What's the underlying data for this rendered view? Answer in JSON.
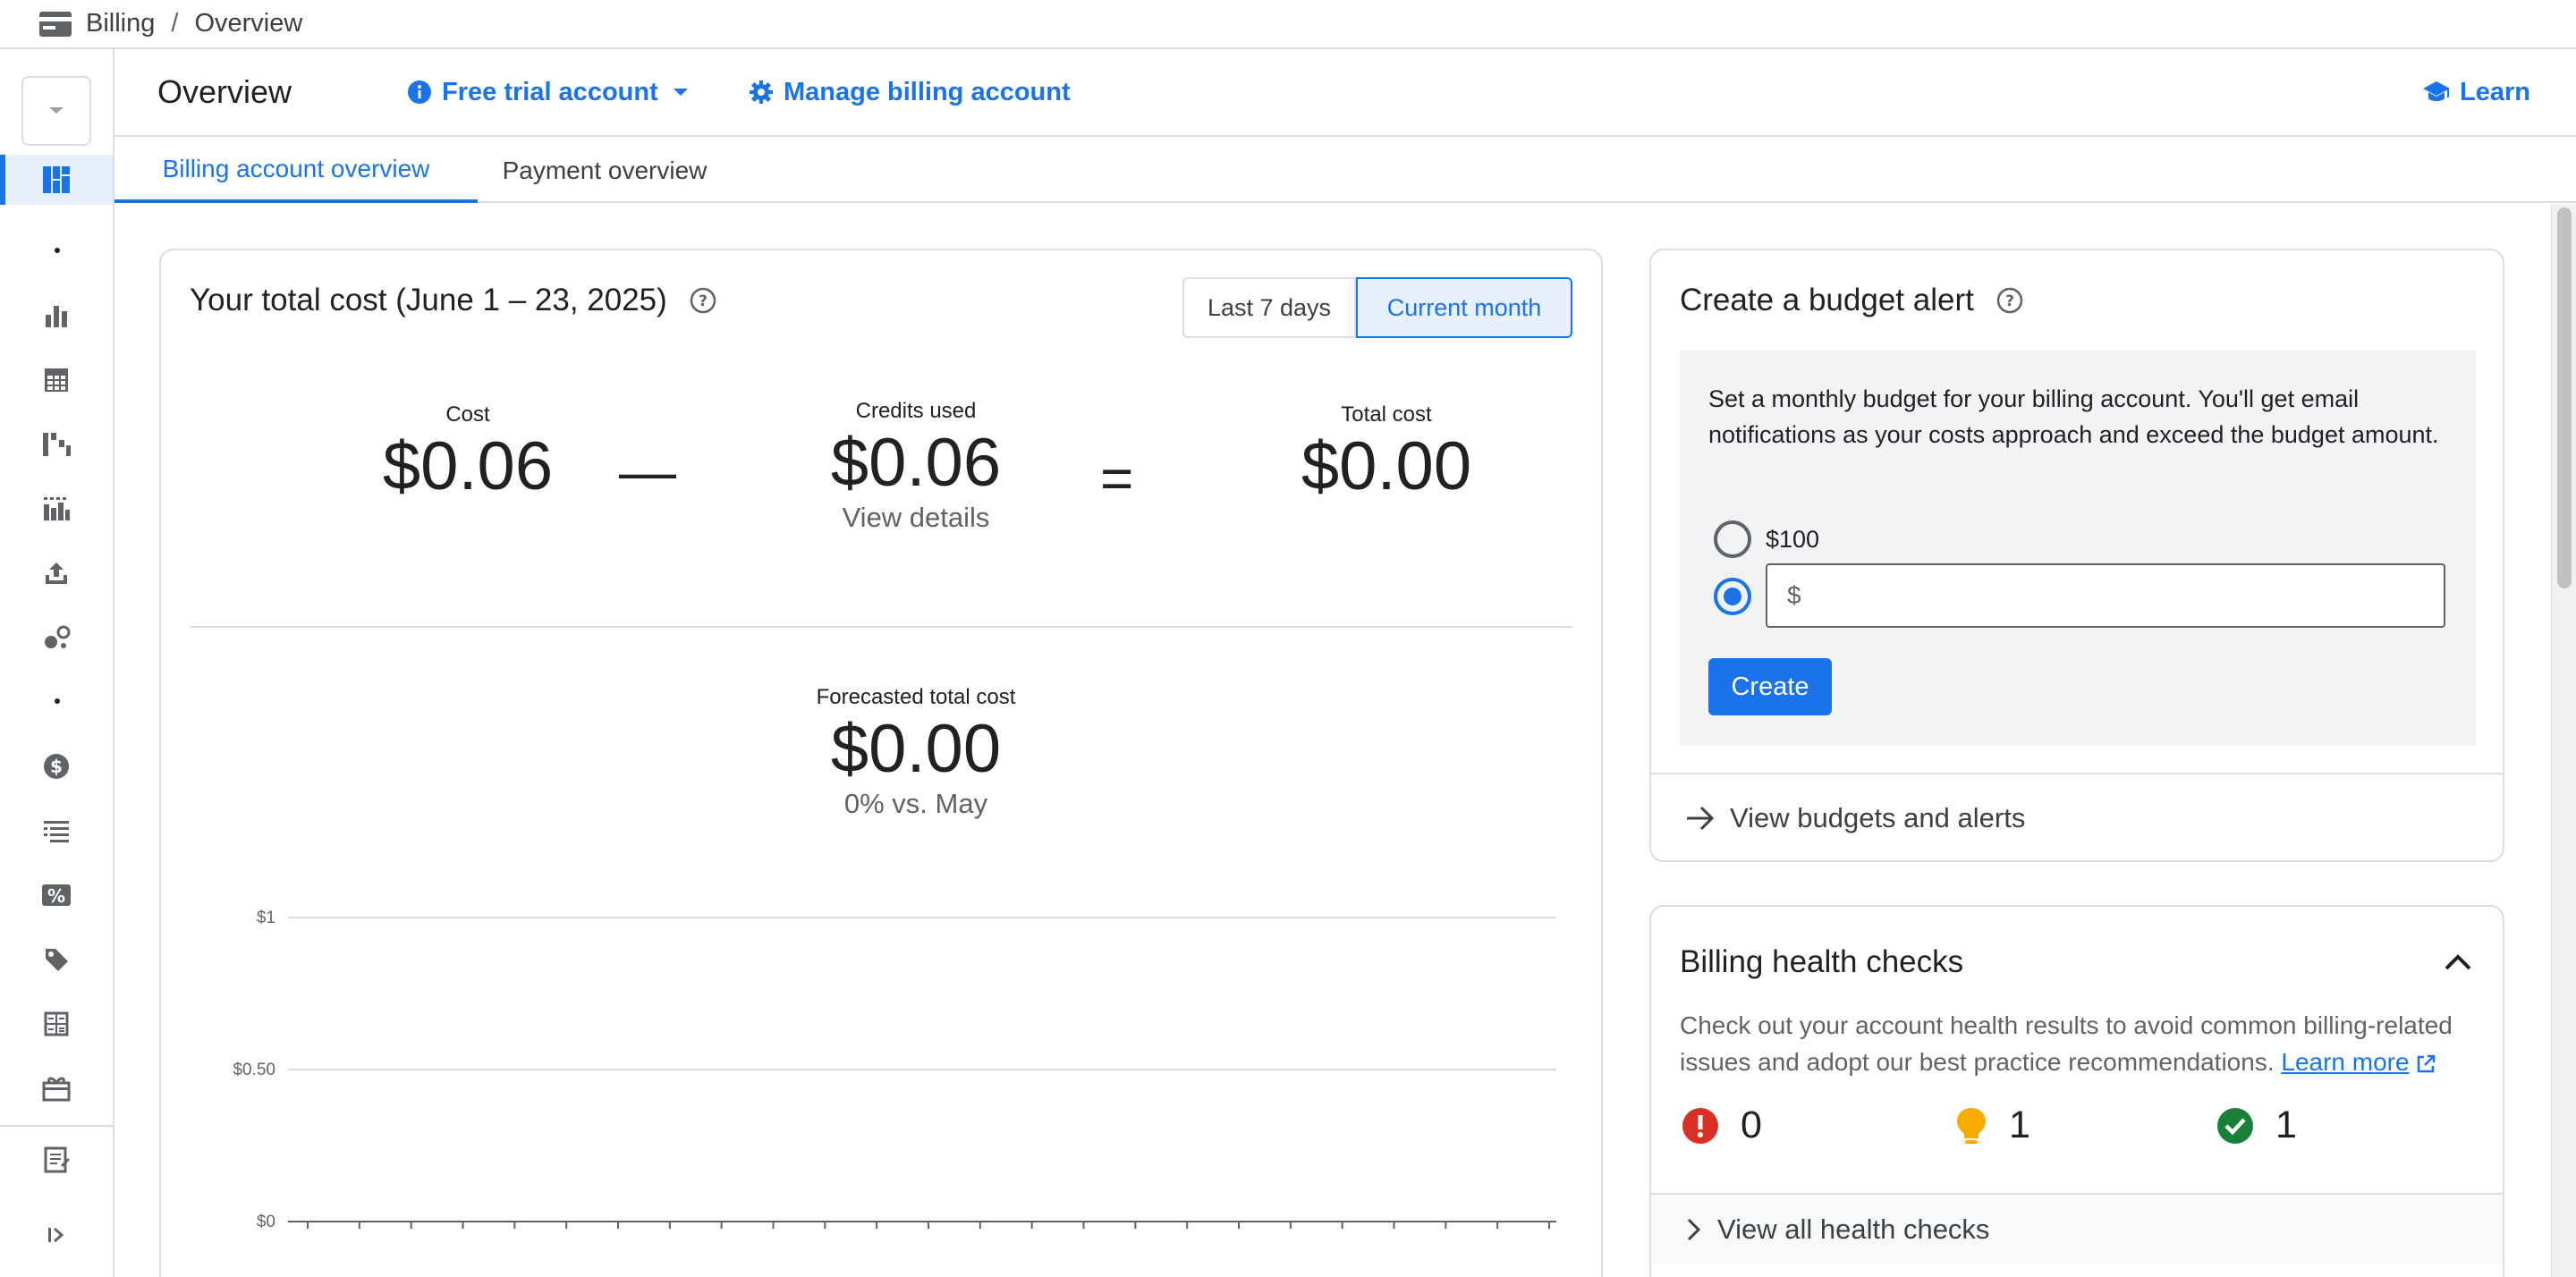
{
  "breadcrumb": {
    "items": [
      "Billing",
      "Overview"
    ],
    "separator": "/"
  },
  "header": {
    "title": "Overview",
    "account_type_label": "Free trial account",
    "manage_label": "Manage billing account",
    "learn_label": "Learn"
  },
  "tabs": [
    {
      "label": "Billing account overview",
      "active": true
    },
    {
      "label": "Payment overview",
      "active": false
    }
  ],
  "left_nav": {
    "icons": [
      "overview-icon",
      "reports-icon",
      "cost-table-icon",
      "cost-breakdown-icon",
      "pricing-icon",
      "export-icon",
      "recommendations-icon",
      "payments-icon",
      "transactions-icon",
      "credits-icon",
      "commitments-icon",
      "budgets-icon",
      "cost-estimator-icon",
      "settings-icon",
      "release-notes-icon",
      "expand-icon"
    ],
    "active": "overview-icon"
  },
  "total_cost_card": {
    "title": "Your total cost (June 1 – 23, 2025)",
    "ranges": [
      "Last 7 days",
      "Current month"
    ],
    "selected_range": "Current month",
    "cost": {
      "label": "Cost",
      "value": "$0.06"
    },
    "minus": "—",
    "credits": {
      "label": "Credits used",
      "value": "$0.06",
      "link": "View details"
    },
    "equals": "=",
    "total": {
      "label": "Total cost",
      "value": "$0.00"
    },
    "forecast": {
      "label": "Forecasted total cost",
      "value": "$0.00",
      "comparison": "0% vs. May"
    }
  },
  "chart_data": {
    "type": "bar",
    "title": "",
    "y_ticks": [
      "$1",
      "$0.50",
      "$0"
    ],
    "ylim": [
      0,
      1
    ],
    "values": [],
    "grid": true
  },
  "budget_card": {
    "title": "Create a budget alert",
    "description": "Set a monthly budget for your billing account. You'll get email notifications as your costs approach and exceed the budget amount.",
    "option_preset": "$100",
    "custom_placeholder": "$",
    "selected_option": "custom",
    "create_label": "Create",
    "footer_link": "View budgets and alerts"
  },
  "health_card": {
    "title": "Billing health checks",
    "description": "Check out your account health results to avoid common billing-related issues and adopt our best practice recommendations.",
    "learn_more": "Learn more",
    "counts": {
      "errors": "0",
      "warnings": "1",
      "passed": "1"
    },
    "footer_link": "View all health checks"
  },
  "colors": {
    "accent": "#1a73e8",
    "error": "#d93025",
    "warning": "#f9ab00",
    "success": "#188038"
  }
}
